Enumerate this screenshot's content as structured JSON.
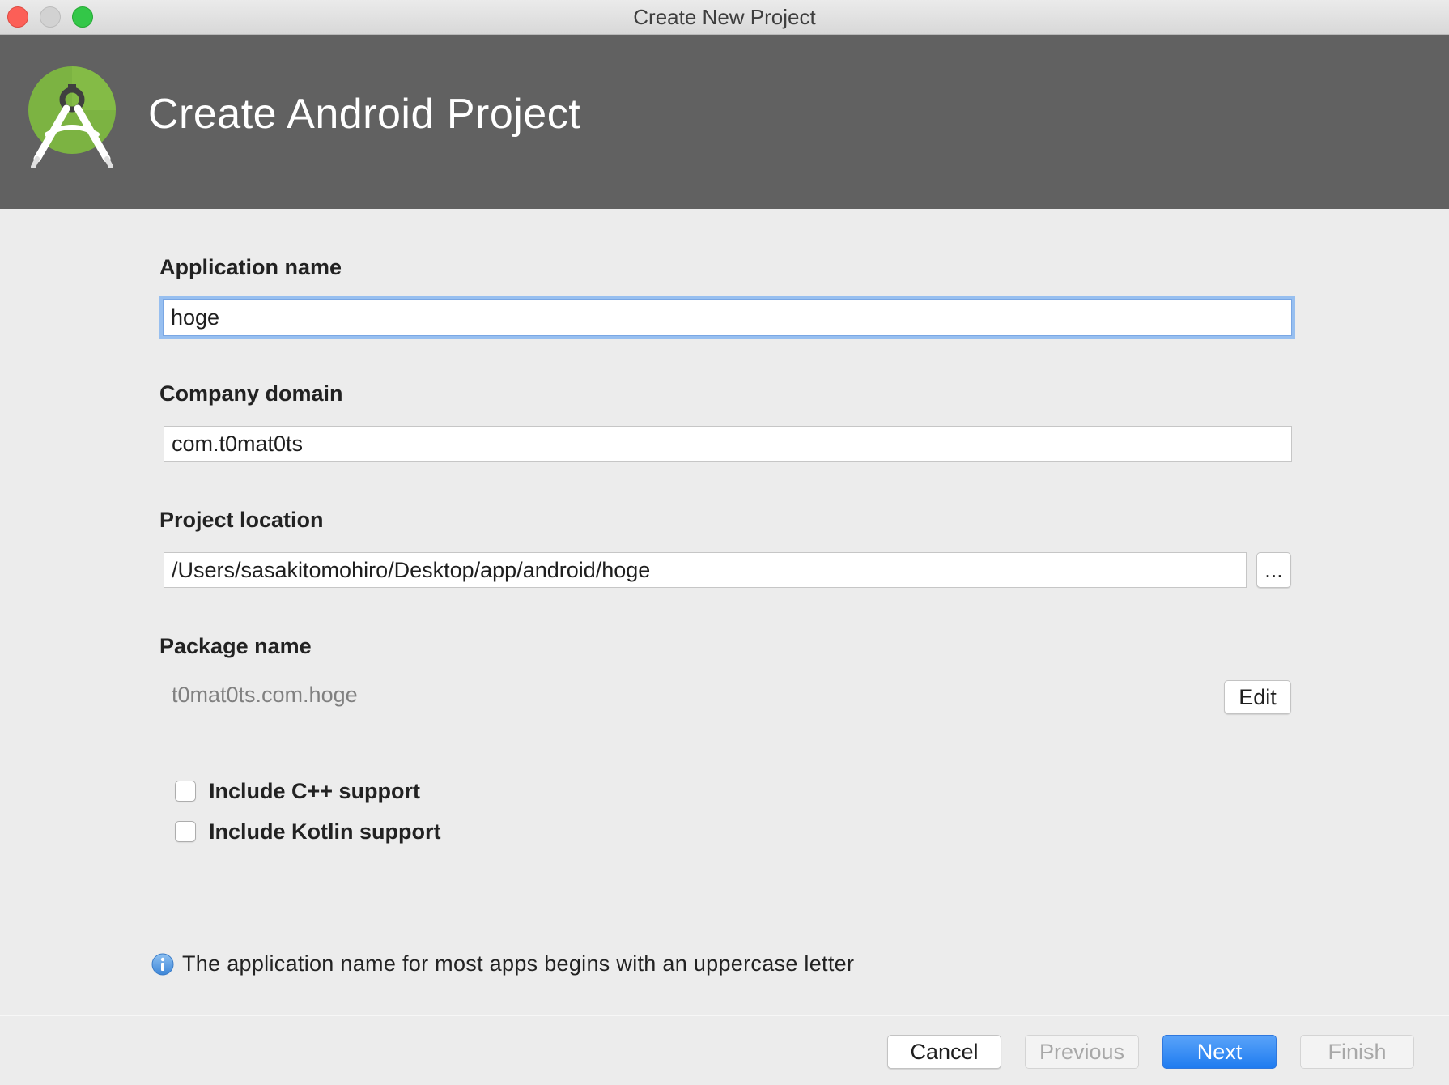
{
  "window": {
    "title": "Create New Project"
  },
  "header": {
    "title": "Create Android Project",
    "logo_icon": "android-studio-logo-icon"
  },
  "form": {
    "application_name": {
      "label": "Application name",
      "value": "hoge"
    },
    "company_domain": {
      "label": "Company domain",
      "value": "com.t0mat0ts"
    },
    "project_location": {
      "label": "Project location",
      "value": "/Users/sasakitomohiro/Desktop/app/android/hoge",
      "browse_label": "..."
    },
    "package_name": {
      "label": "Package name",
      "value": "t0mat0ts.com.hoge",
      "edit_label": "Edit"
    },
    "options": [
      {
        "label": "Include C++ support",
        "checked": false
      },
      {
        "label": "Include Kotlin support",
        "checked": false
      }
    ]
  },
  "info": {
    "icon": "info-icon",
    "message": "The application name for most apps begins with an uppercase letter"
  },
  "footer": {
    "cancel_label": "Cancel",
    "previous_label": "Previous",
    "next_label": "Next",
    "finish_label": "Finish"
  },
  "colors": {
    "banner": "#616161",
    "primary_button": "#2a84f5",
    "focus_ring": "#97bff0",
    "logo_green": "#7cb342"
  }
}
